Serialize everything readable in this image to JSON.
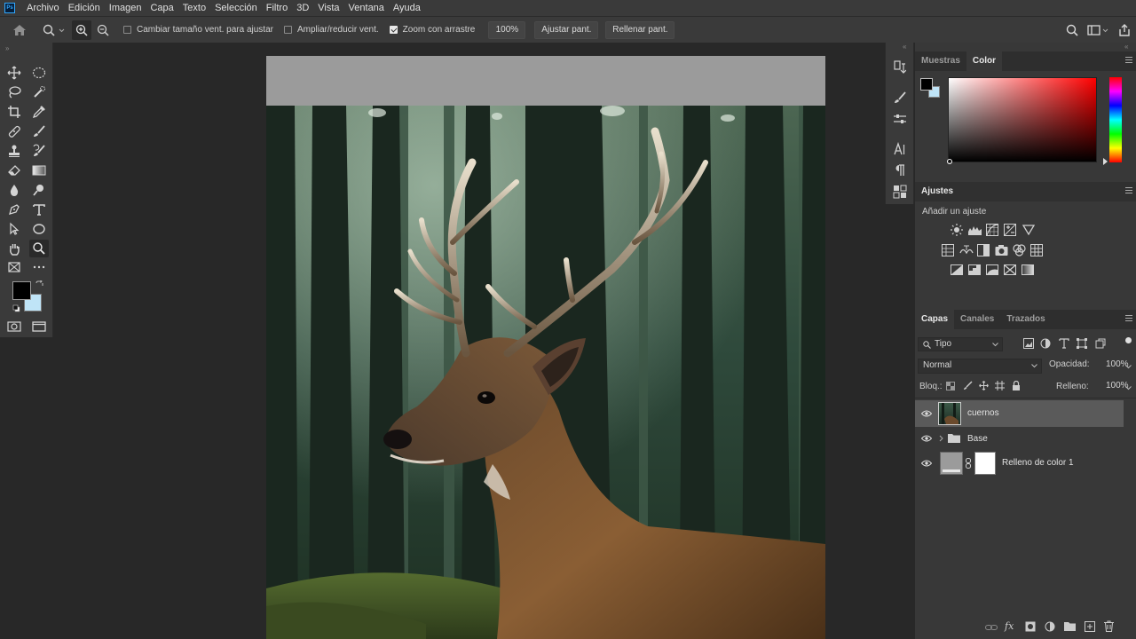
{
  "menu": [
    "Archivo",
    "Edición",
    "Imagen",
    "Capa",
    "Texto",
    "Selección",
    "Filtro",
    "3D",
    "Vista",
    "Ventana",
    "Ayuda"
  ],
  "app_logo": "Ps",
  "options": {
    "resize_windows_label": "Cambiar tamaño vent. para ajustar",
    "resize_windows_checked": false,
    "zoom_all_label": "Ampliar/reducir vent.",
    "zoom_all_checked": false,
    "scrubby_zoom_label": "Zoom con arrastre",
    "scrubby_zoom_checked": true,
    "zoom_value": "100%",
    "fit_screen_label": "Ajustar pant.",
    "fill_screen_label": "Rellenar pant."
  },
  "colors": {
    "foreground": "#000000",
    "background": "#bfe4f7",
    "accent": "#31a8ff"
  },
  "color_panel": {
    "tabs": [
      "Muestras",
      "Color"
    ],
    "active_tab": "Color"
  },
  "adjustments_panel": {
    "title": "Ajustes",
    "subtitle": "Añadir un ajuste"
  },
  "layers_panel": {
    "tabs": [
      "Capas",
      "Canales",
      "Trazados"
    ],
    "active_tab": "Capas",
    "filter_kind": "Tipo",
    "blend_mode": "Normal",
    "opacity_label": "Opacidad:",
    "opacity_value": "100%",
    "lock_label": "Bloq.:",
    "fill_label": "Relleno:",
    "fill_value": "100%",
    "layers": [
      {
        "name": "cuernos",
        "type": "image",
        "visible": true,
        "selected": true
      },
      {
        "name": "Base",
        "type": "group",
        "visible": true,
        "selected": false
      },
      {
        "name": "Relleno de color 1",
        "type": "fill",
        "visible": true,
        "selected": false
      }
    ]
  },
  "document": {
    "fill_layer_color": "#9b9b9b",
    "subject": "deer with antlers in a forest"
  }
}
